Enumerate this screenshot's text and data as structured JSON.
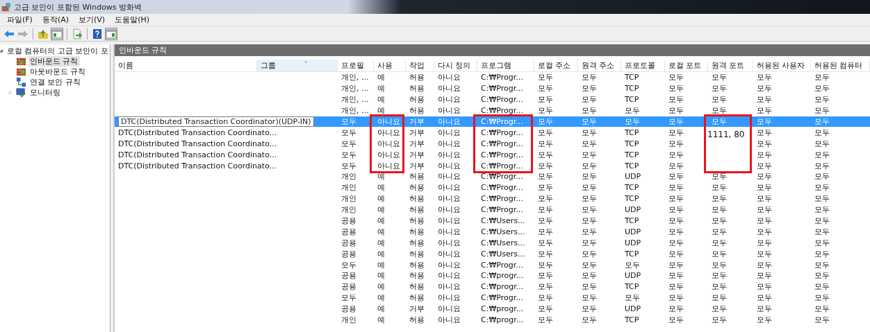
{
  "window": {
    "title": "고급 보안이 포함된 Windows 방화벽"
  },
  "menu": [
    "파일(F)",
    "동작(A)",
    "보기(V)",
    "도움말(H)"
  ],
  "toolbar": [
    {
      "kind": "back",
      "disabled": false,
      "pressed": false
    },
    {
      "kind": "forward",
      "disabled": true,
      "pressed": false
    },
    {
      "kind": "sep"
    },
    {
      "kind": "up",
      "disabled": false,
      "pressed": false
    },
    {
      "kind": "tree",
      "disabled": false,
      "pressed": true
    },
    {
      "kind": "sep"
    },
    {
      "kind": "export",
      "disabled": false,
      "pressed": false
    },
    {
      "kind": "sep"
    },
    {
      "kind": "help",
      "disabled": false,
      "pressed": false
    },
    {
      "kind": "pane",
      "disabled": false,
      "pressed": true
    }
  ],
  "tree": {
    "label": "로컬 컴퓨터의 고급 보안이 포",
    "children": [
      {
        "label": "인바운드 규칙",
        "kind": "inbound",
        "selected": true
      },
      {
        "label": "아웃바운드 규칙",
        "kind": "outbound",
        "selected": false
      },
      {
        "label": "연결 보안 규칙",
        "kind": "connection",
        "selected": false
      },
      {
        "label": "모니터링",
        "kind": "monitor",
        "selected": false,
        "expanded": false
      }
    ]
  },
  "panel": {
    "title": "인바운드 규칙"
  },
  "table": {
    "columns": [
      {
        "label": "이름",
        "sorted": false,
        "marked": false
      },
      {
        "label": "그룹",
        "sorted": true,
        "marked": false
      },
      {
        "label": "프로필",
        "sorted": false,
        "marked": false
      },
      {
        "label": "사용",
        "sorted": false,
        "marked": true
      },
      {
        "label": "작업",
        "sorted": false,
        "marked": false
      },
      {
        "label": "다시 정의",
        "sorted": false,
        "marked": false
      },
      {
        "label": "프로그램",
        "sorted": false,
        "marked": true
      },
      {
        "label": "로컬 주소",
        "sorted": false,
        "marked": false
      },
      {
        "label": "원격 주소",
        "sorted": false,
        "marked": false
      },
      {
        "label": "프로토콜",
        "sorted": false,
        "marked": false
      },
      {
        "label": "로컬 포트",
        "sorted": false,
        "marked": false
      },
      {
        "label": "원격 포트",
        "sorted": false,
        "marked": true,
        "note": "1111, 80"
      },
      {
        "label": "허용된 사용자",
        "sorted": false,
        "marked": false
      },
      {
        "label": "허용된 컴퓨터",
        "sorted": false,
        "marked": false
      }
    ],
    "rows": [
      {
        "selected": false,
        "marked": false,
        "cells": [
          "",
          "",
          "개인, ...",
          "예",
          "허용",
          "아니요",
          "C:₩Progr...",
          "모두",
          "모두",
          "TCP",
          "모두",
          "모두",
          "모두",
          "모두"
        ]
      },
      {
        "selected": false,
        "marked": false,
        "cells": [
          "",
          "",
          "개인, ...",
          "예",
          "허용",
          "아니요",
          "C:₩Progr...",
          "모두",
          "모두",
          "TCP",
          "모두",
          "모두",
          "모두",
          "모두"
        ]
      },
      {
        "selected": false,
        "marked": false,
        "cells": [
          "",
          "",
          "개인, ...",
          "예",
          "허용",
          "아니요",
          "C:₩Progr...",
          "모두",
          "모두",
          "TCP",
          "모두",
          "모두",
          "모두",
          "모두"
        ]
      },
      {
        "selected": false,
        "marked": false,
        "cells": [
          "",
          "",
          "개인, ...",
          "예",
          "허용",
          "아니요",
          "C:₩Progr...",
          "모두",
          "모두",
          "모두",
          "모두",
          "모두",
          "모두",
          "모두"
        ]
      },
      {
        "selected": true,
        "marked": true,
        "blocked": true,
        "tooltip": true,
        "cells": [
          "DTC(Distributed Transaction Coordinator)(UDP-IN)",
          "",
          "모두",
          "아니요",
          "거부",
          "아니요",
          "C:₩Progr...",
          "모두",
          "모두",
          "모두",
          "모두",
          "모두",
          "모두",
          "모두"
        ]
      },
      {
        "selected": false,
        "marked": true,
        "blocked": true,
        "cells": [
          "DTC(Distributed Transaction Coordinato...",
          "",
          "모두",
          "아니요",
          "거부",
          "아니요",
          "C:₩Progr...",
          "모두",
          "모두",
          "TCP",
          "모두",
          "",
          "모두",
          "모두"
        ]
      },
      {
        "selected": false,
        "marked": true,
        "blocked": true,
        "cells": [
          "DTC(Distributed Transaction Coordinato...",
          "",
          "모두",
          "아니요",
          "거부",
          "아니요",
          "C:₩Progr...",
          "모두",
          "모두",
          "TCP",
          "모두",
          "",
          "모두",
          "모두"
        ]
      },
      {
        "selected": false,
        "marked": true,
        "blocked": true,
        "cells": [
          "DTC(Distributed Transaction Coordinato...",
          "",
          "모두",
          "아니요",
          "거부",
          "아니요",
          "C:₩Progr...",
          "모두",
          "모두",
          "TCP",
          "모두",
          "",
          "모두",
          "모두"
        ]
      },
      {
        "selected": false,
        "marked": true,
        "blocked": true,
        "cells": [
          "DTC(Distributed Transaction Coordinato...",
          "",
          "모두",
          "아니요",
          "거부",
          "아니요",
          "C:₩Progr...",
          "모두",
          "모두",
          "TCP",
          "모두",
          "",
          "모두",
          "모두"
        ]
      },
      {
        "selected": false,
        "marked": false,
        "cells": [
          "",
          "",
          "개인",
          "예",
          "허용",
          "아니요",
          "C:₩Progr...",
          "모두",
          "모두",
          "UDP",
          "모두",
          "모두",
          "모두",
          "모두"
        ]
      },
      {
        "selected": false,
        "marked": false,
        "cells": [
          "",
          "",
          "개인",
          "예",
          "허용",
          "아니요",
          "C:₩Progr...",
          "모두",
          "모두",
          "TCP",
          "모두",
          "모두",
          "모두",
          "모두"
        ]
      },
      {
        "selected": false,
        "marked": false,
        "cells": [
          "",
          "",
          "개인",
          "예",
          "허용",
          "아니요",
          "C:₩Progr...",
          "모두",
          "모두",
          "TCP",
          "모두",
          "모두",
          "모두",
          "모두"
        ]
      },
      {
        "selected": false,
        "marked": false,
        "cells": [
          "",
          "",
          "개인",
          "예",
          "허용",
          "아니요",
          "C:₩Progr...",
          "모두",
          "모두",
          "UDP",
          "모두",
          "모두",
          "모두",
          "모두"
        ]
      },
      {
        "selected": false,
        "marked": false,
        "cells": [
          "",
          "",
          "공용",
          "예",
          "허용",
          "아니요",
          "C:₩Users...",
          "모두",
          "모두",
          "TCP",
          "모두",
          "모두",
          "모두",
          "모두"
        ]
      },
      {
        "selected": false,
        "marked": false,
        "cells": [
          "",
          "",
          "공용",
          "예",
          "허용",
          "아니요",
          "C:₩Users...",
          "모두",
          "모두",
          "UDP",
          "모두",
          "모두",
          "모두",
          "모두"
        ]
      },
      {
        "selected": false,
        "marked": false,
        "cells": [
          "",
          "",
          "공용",
          "예",
          "허용",
          "아니요",
          "C:₩Users...",
          "모두",
          "모두",
          "UDP",
          "모두",
          "모두",
          "모두",
          "모두"
        ]
      },
      {
        "selected": false,
        "marked": false,
        "cells": [
          "",
          "",
          "공용",
          "예",
          "허용",
          "아니요",
          "C:₩Users...",
          "모두",
          "모두",
          "TCP",
          "모두",
          "모두",
          "모두",
          "모두"
        ]
      },
      {
        "selected": false,
        "marked": false,
        "cells": [
          "",
          "",
          "모두",
          "예",
          "허용",
          "아니요",
          "C:₩Progr...",
          "모두",
          "모두",
          "모두",
          "모두",
          "모두",
          "모두",
          "모두"
        ]
      },
      {
        "selected": false,
        "marked": false,
        "cells": [
          "",
          "",
          "공용",
          "예",
          "허용",
          "아니요",
          "C:₩progr...",
          "모두",
          "모두",
          "UDP",
          "모두",
          "모두",
          "모두",
          "모두"
        ]
      },
      {
        "selected": false,
        "marked": false,
        "cells": [
          "",
          "",
          "공용",
          "예",
          "허용",
          "아니요",
          "C:₩progr...",
          "모두",
          "모두",
          "TCP",
          "모두",
          "모두",
          "모두",
          "모두"
        ]
      },
      {
        "selected": false,
        "marked": false,
        "cells": [
          "",
          "",
          "모두",
          "예",
          "허용",
          "아니요",
          "C:₩Progr...",
          "모두",
          "모두",
          "모두",
          "모두",
          "모두",
          "모두",
          "모두"
        ]
      },
      {
        "selected": false,
        "marked": false,
        "cells": [
          "",
          "",
          "공용",
          "예",
          "거부",
          "아니요",
          "C:₩progr...",
          "모두",
          "모두",
          "UDP",
          "모두",
          "모두",
          "모두",
          "모두"
        ]
      },
      {
        "selected": false,
        "marked": false,
        "cells": [
          "",
          "",
          "개인",
          "예",
          "허용",
          "아니요",
          "C:₩progr...",
          "모두",
          "모두",
          "TCP",
          "모두",
          "모두",
          "모두",
          "모두"
        ]
      }
    ]
  }
}
